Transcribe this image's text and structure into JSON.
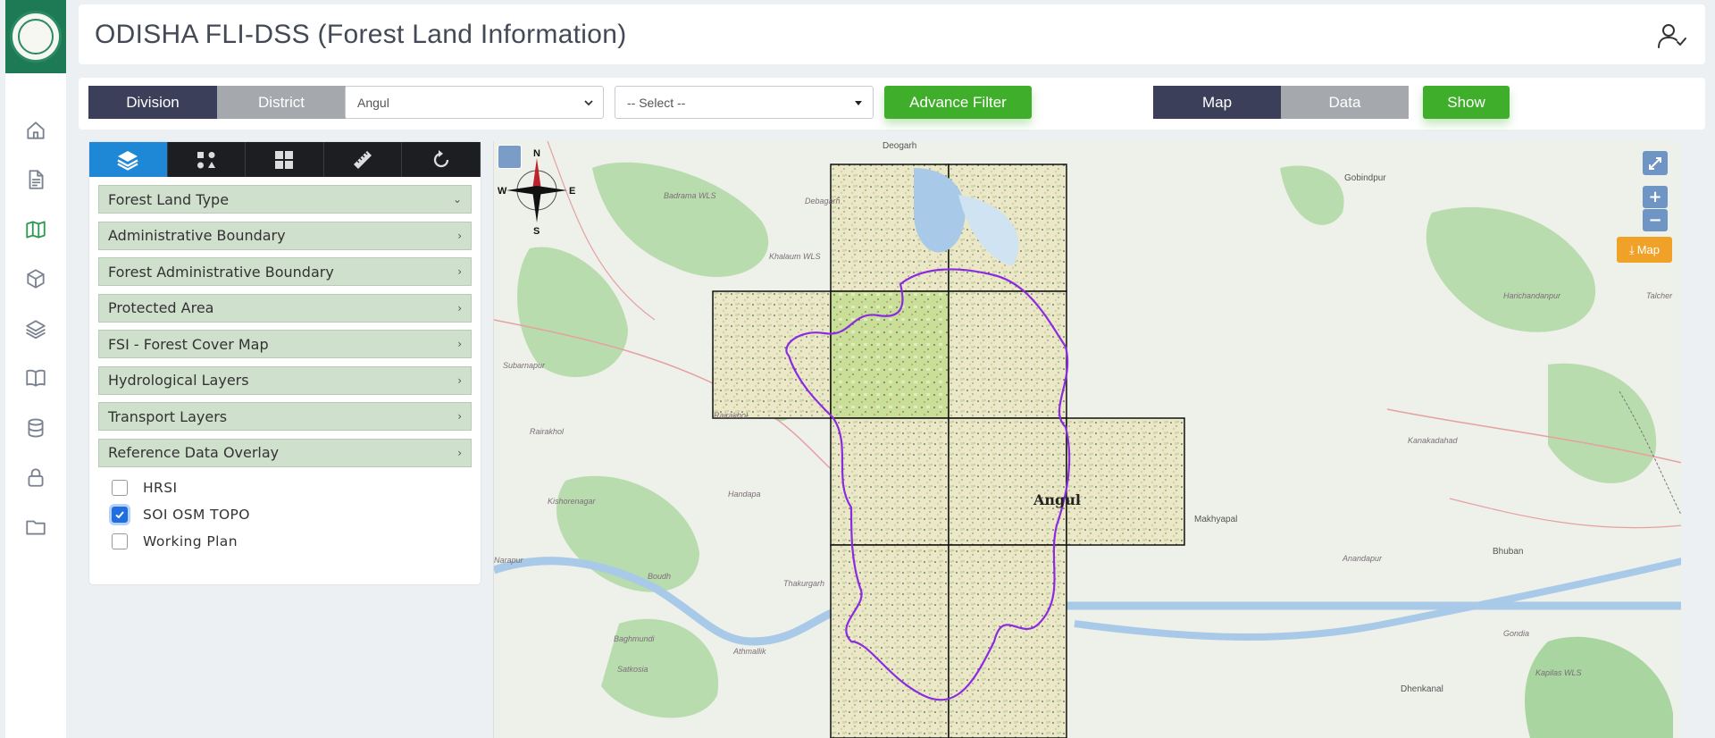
{
  "app": {
    "title": "ODISHA FLI-DSS (Forest Land Information)"
  },
  "sidebar": {
    "items": [
      {
        "name": "home-icon",
        "active": false
      },
      {
        "name": "document-icon",
        "active": false
      },
      {
        "name": "map-icon",
        "active": true
      },
      {
        "name": "cube-icon",
        "active": false
      },
      {
        "name": "layers-icon",
        "active": false
      },
      {
        "name": "book-icon",
        "active": false
      },
      {
        "name": "database-icon",
        "active": false
      },
      {
        "name": "lock-icon",
        "active": false
      },
      {
        "name": "folder-icon",
        "active": false
      }
    ]
  },
  "filters": {
    "basis": {
      "options": [
        "Division",
        "District"
      ],
      "selected": "Division"
    },
    "district_select": {
      "value": "Angul"
    },
    "division_select": {
      "value": "-- Select --"
    },
    "advance_filter_label": "Advance Filter",
    "view": {
      "options": [
        "Map",
        "Data"
      ],
      "selected": "Map"
    },
    "show_label": "Show"
  },
  "panel": {
    "tools": [
      "layers-icon",
      "shapes-icon",
      "grid-icon",
      "ruler-icon",
      "refresh-icon"
    ],
    "accordion": [
      {
        "label": "Forest Land Type",
        "expanded": true
      },
      {
        "label": "Administrative Boundary",
        "expanded": false
      },
      {
        "label": "Forest Administrative Boundary",
        "expanded": false
      },
      {
        "label": "Protected Area",
        "expanded": false
      },
      {
        "label": "FSI - Forest Cover Map",
        "expanded": false
      },
      {
        "label": "Hydrological Layers",
        "expanded": false
      },
      {
        "label": "Transport Layers",
        "expanded": false
      },
      {
        "label": "Reference Data Overlay",
        "expanded": false
      }
    ],
    "checkboxes": [
      {
        "label": "HRSI",
        "checked": false
      },
      {
        "label": "SOI OSM TOPO",
        "checked": true
      },
      {
        "label": "Working Plan",
        "checked": false
      }
    ]
  },
  "map": {
    "compass": {
      "n": "N",
      "s": "S",
      "e": "E",
      "w": "W"
    },
    "download_label": "Map",
    "zoom_in": "+",
    "zoom_out": "−",
    "district_label": "Angul",
    "places": [
      "Deogarh",
      "Debagarh",
      "Badrama WLS",
      "Khalaum WLS",
      "Rairakhol",
      "Rairakhol",
      "Kishorenagar",
      "Handapa",
      "Boudh",
      "Thakurgarh",
      "Athmallik",
      "Baghmundi",
      "Satkosia",
      "Gobindpur",
      "Harichandanpur",
      "Talcher",
      "Makhyapal",
      "Anandapur",
      "Kanakadahad",
      "Bhuban",
      "Dhenkanal",
      "Gondia",
      "Kapilas WLS",
      "Narapur",
      "Subarnapur"
    ],
    "colors": {
      "boundary": "#8a2be2",
      "green": "#a8d5a0",
      "water": "#a8c9e8",
      "road": "#e6a0a0"
    }
  }
}
